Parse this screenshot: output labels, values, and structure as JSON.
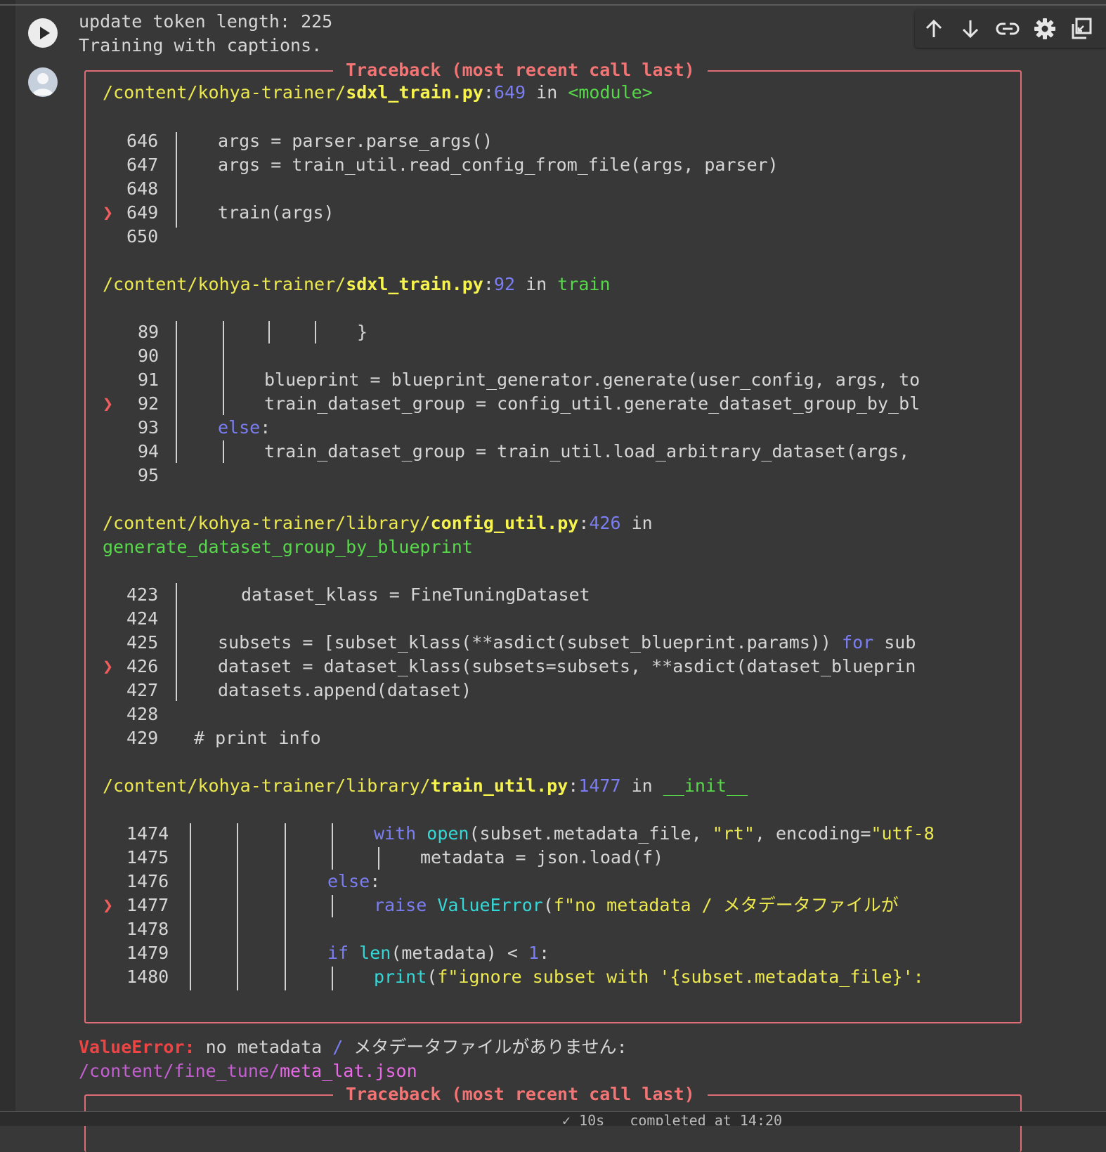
{
  "cell_toolbar": {
    "items": [
      "move-up",
      "move-down",
      "link",
      "settings",
      "mirror"
    ]
  },
  "output": {
    "pre_lines": [
      "update token length: 225",
      "Training with captions."
    ],
    "traceback_title": "Traceback (most recent call last)",
    "frames": [
      {
        "path_dir": "/content/kohya-trainer/",
        "file": "sdxl_train.py",
        "lineno": "649",
        "func": "<module>",
        "lines": [
          {
            "n": "646",
            "code": "args = parser.parse_args()"
          },
          {
            "n": "647",
            "code": "args = train_util.read_config_from_file(args, parser)"
          },
          {
            "n": "648",
            "code": ""
          },
          {
            "n": "649",
            "code": "train(args)"
          },
          {
            "n": "650",
            "code": ""
          }
        ]
      },
      {
        "path_dir": "/content/kohya-trainer/",
        "file": "sdxl_train.py",
        "lineno": "92",
        "func": "train",
        "lines": [
          {
            "n": "89",
            "code": "}"
          },
          {
            "n": "90",
            "code": ""
          },
          {
            "n": "91",
            "code": "blueprint = blueprint_generator.generate(user_config, args, to"
          },
          {
            "n": "92",
            "code": "train_dataset_group = config_util.generate_dataset_group_by_bl"
          },
          {
            "n": "93",
            "kw": "else",
            "code": ":"
          },
          {
            "n": "94",
            "code": "train_dataset_group = train_util.load_arbitrary_dataset(args,"
          },
          {
            "n": "95",
            "code": ""
          }
        ]
      },
      {
        "path_dir": "/content/kohya-trainer/library/",
        "file": "config_util.py",
        "lineno": "426",
        "func": "generate_dataset_group_by_blueprint",
        "lines": [
          {
            "n": "423",
            "code": "dataset_klass = FineTuningDataset"
          },
          {
            "n": "424",
            "code": ""
          },
          {
            "n": "425",
            "code": "subsets = [subset_klass(**asdict(subset_blueprint.params)) ",
            "kw": "for",
            "tail": " sub"
          },
          {
            "n": "426",
            "code": "dataset = dataset_klass(subsets=subsets, **asdict(dataset_blueprin"
          },
          {
            "n": "427",
            "code": "datasets.append(dataset)"
          },
          {
            "n": "428",
            "code": ""
          },
          {
            "n": "429",
            "code": "# print info"
          }
        ]
      },
      {
        "path_dir": "/content/kohya-trainer/library/",
        "file": "train_util.py",
        "lineno": "1477",
        "func": "__init__",
        "lines": [
          {
            "n": "1474",
            "kw": "with",
            "bi": "open",
            "code": "(subset.metadata_file, ",
            "str": "\"rt\"",
            "tail": ", encoding=",
            "str2": "\"utf-8"
          },
          {
            "n": "1475",
            "code": "metadata = json.load(f)"
          },
          {
            "n": "1476",
            "kw": "else",
            "code": ":"
          },
          {
            "n": "1477",
            "kw": "raise",
            "bi": "ValueError",
            "code": "(",
            "str": "f\"no metadata / メタデータファイルが"
          },
          {
            "n": "1478",
            "code": ""
          },
          {
            "n": "1479",
            "kw": "if",
            "bi": "len",
            "code": "(metadata) < ",
            "num": "1",
            "tail": ":"
          },
          {
            "n": "1480",
            "bi": "print",
            "code": "(",
            "str": "f\"ignore subset with '{subset.metadata_file}':"
          }
        ]
      }
    ],
    "error_type": "ValueError:",
    "error_msg_a": " no metadata ",
    "error_slash": "/",
    "error_msg_b": " メタデータファイルがありません:",
    "error_path_dir": "/content/fine_tune/",
    "error_path_file": "meta_lat.json"
  },
  "in": "in",
  "status": {
    "text": "✓ 10s   completed at 14:20"
  }
}
